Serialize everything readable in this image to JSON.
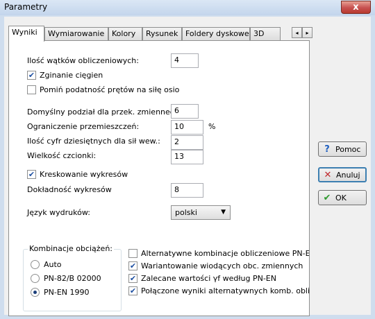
{
  "window": {
    "title": "Parametry",
    "close_glyph": "x"
  },
  "tabs": [
    "Wyniki",
    "Wymiarowanie",
    "Kolory",
    "Rysunek",
    "Foldery dyskowe",
    "3D"
  ],
  "tab_scroll": {
    "left": "◂",
    "right": "▸"
  },
  "form": {
    "threads_label": "Ilość wątków obliczeniowych:",
    "threads_value": "4",
    "bending_label": "Zginanie cięgien",
    "ignore_label": "Pomiń podatność prętów na siłę osiową",
    "division_label": "Domyślny podział dla przek. zmiennego:",
    "division_value": "6",
    "displacement_label": "Ograniczenie przemieszczeń:",
    "displacement_value": "10",
    "displacement_unit": "%",
    "decimals_label": "Ilość cyfr dziesiętnych dla sił wew.:",
    "decimals_value": "2",
    "fontsize_label": "Wielkość czcionki:",
    "fontsize_value": "13",
    "hatching_label": "Kreskowanie wykresów",
    "accuracy_label": "Dokładność wykresów",
    "accuracy_value": "8",
    "language_label": "Język wydruków:",
    "language_value": "polski"
  },
  "combinations": {
    "title": "Kombinacje obciążeń:",
    "options": [
      "Auto",
      "PN-82/B 02000",
      "PN-EN 1990"
    ],
    "selected": "PN-EN 1990"
  },
  "options": [
    {
      "label": "Alternatywne kombinacje obliczeniowe PN-EN",
      "checked": false
    },
    {
      "label": "Wariantowanie wiodących obc. zmiennych",
      "checked": true
    },
    {
      "label": "Zalecane wartości γf według PN-EN",
      "checked": true
    },
    {
      "label": "Połączone wyniki alternatywnych komb. oblicz.",
      "checked": true
    }
  ],
  "buttons": {
    "help": "Pomoc",
    "cancel": "Anuluj",
    "ok": "OK"
  },
  "checks": {
    "bending": true,
    "ignore": false,
    "hatching": true
  },
  "icons": {
    "help": "question-icon",
    "cancel": "cross-icon",
    "ok": "checkmark-icon"
  },
  "colors": {
    "help_icon": "#1f5fbf",
    "cancel_icon": "#c0282c",
    "ok_icon": "#2e9a2e",
    "focus": "#3c7fb1"
  }
}
